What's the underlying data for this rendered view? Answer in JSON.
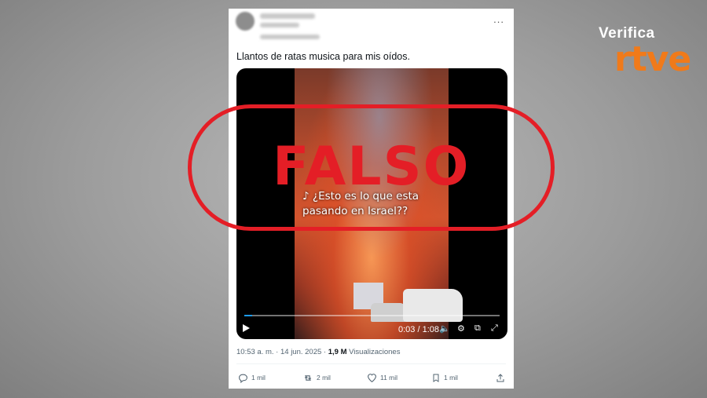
{
  "brand": {
    "top": "Verifica",
    "logo": "rtve",
    "accent_color": "#f07a1a"
  },
  "tweet": {
    "text": "Llantos de ratas musica para mis oídos.",
    "more_label": "...",
    "video": {
      "caption_line1": "¿Esto es lo que esta",
      "caption_line2": "pasando en Israel??",
      "tiktok_icon": "tiktok-icon",
      "time": "0:03 / 1:08",
      "progress": 0.03
    },
    "meta": {
      "time": "10:53 a. m.",
      "sep": "·",
      "date": "14 jun. 2025",
      "sep2": "·",
      "views": "1,9 M",
      "views_label": "Visualizaciones"
    },
    "actions": [
      {
        "icon": "reply-icon",
        "count": "1 mil"
      },
      {
        "icon": "retweet-icon",
        "count": "2 mil"
      },
      {
        "icon": "like-icon",
        "count": "11 mil"
      },
      {
        "icon": "bookmark-icon",
        "count": "1 mil"
      },
      {
        "icon": "share-icon",
        "count": ""
      }
    ]
  },
  "stamp": {
    "text": "FALSO",
    "color": "#e41e26"
  }
}
